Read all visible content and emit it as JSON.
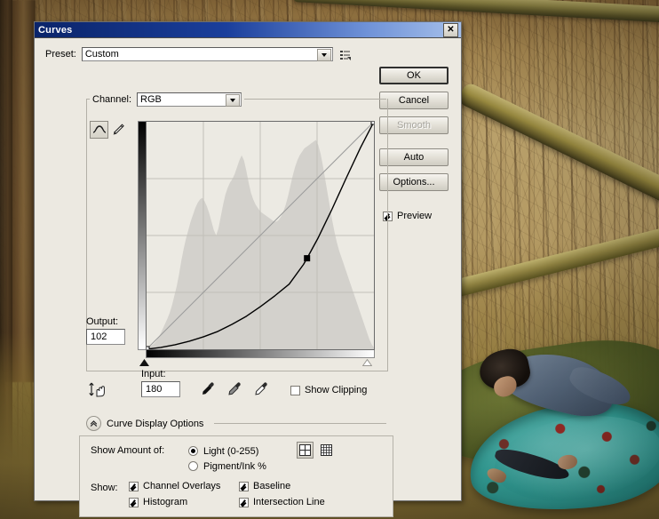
{
  "window": {
    "title": "Curves",
    "close_label": "✕"
  },
  "preset": {
    "label": "Preset:",
    "value": "Custom",
    "menu_icon": "preset-menu-icon"
  },
  "buttons": {
    "ok": "OK",
    "cancel": "Cancel",
    "smooth": "Smooth",
    "auto": "Auto",
    "options": "Options..."
  },
  "preview": {
    "label": "Preview",
    "checked": true
  },
  "channel": {
    "label": "Channel:",
    "value": "RGB"
  },
  "tools": {
    "curve_icon": "curve-tool-icon",
    "pencil_icon": "pencil-tool-icon",
    "active": "curve"
  },
  "output": {
    "label": "Output:",
    "value": "102"
  },
  "input": {
    "label": "Input:",
    "value": "180"
  },
  "eyedroppers": [
    "black-point-eyedropper",
    "gray-point-eyedropper",
    "white-point-eyedropper"
  ],
  "show_clipping": {
    "label": "Show Clipping",
    "checked": false
  },
  "curve_display_options": {
    "label": "Curve Display Options",
    "expanded": true,
    "show_amount_label": "Show Amount of:",
    "radios": [
      {
        "label": "Light  (0-255)",
        "selected": true
      },
      {
        "label": "Pigment/Ink %",
        "selected": false
      }
    ],
    "grid_buttons": [
      {
        "name": "grid-quarter-tones",
        "selected": true
      },
      {
        "name": "grid-tenth-tones",
        "selected": false
      }
    ],
    "show_label": "Show:",
    "checkboxes": [
      {
        "label": "Channel Overlays",
        "checked": true
      },
      {
        "label": "Baseline",
        "checked": true
      },
      {
        "label": "Histogram",
        "checked": true
      },
      {
        "label": "Intersection Line",
        "checked": true
      }
    ]
  },
  "chart_data": {
    "type": "line",
    "title": "Tone curve (RGB)",
    "xlabel": "Input",
    "ylabel": "Output",
    "xlim": [
      0,
      255
    ],
    "ylim": [
      0,
      255
    ],
    "grid": true,
    "grid_divisions": 4,
    "series": [
      {
        "name": "Baseline",
        "style": "diagonal-gray",
        "x": [
          0,
          255
        ],
        "y": [
          0,
          255
        ]
      },
      {
        "name": "Curve",
        "style": "black",
        "control_points": [
          {
            "input": 0,
            "output": 0
          },
          {
            "input": 180,
            "output": 102
          },
          {
            "input": 255,
            "output": 255
          }
        ],
        "x": [
          0,
          16,
          32,
          48,
          64,
          80,
          96,
          112,
          128,
          144,
          160,
          176,
          180,
          192,
          208,
          224,
          240,
          255
        ],
        "y": [
          0,
          2,
          5,
          9,
          14,
          20,
          28,
          37,
          48,
          60,
          73,
          95,
          102,
          124,
          157,
          192,
          226,
          255
        ]
      }
    ],
    "histogram_note": "grayscale image histogram shown behind curve"
  },
  "colors": {
    "titlebar_start": "#0a246a",
    "titlebar_end": "#a6c0ea",
    "dialog_bg": "#ece9e1",
    "curve_line": "#000000",
    "baseline": "#9a9a9a",
    "histogram": "#d2d0ca"
  }
}
